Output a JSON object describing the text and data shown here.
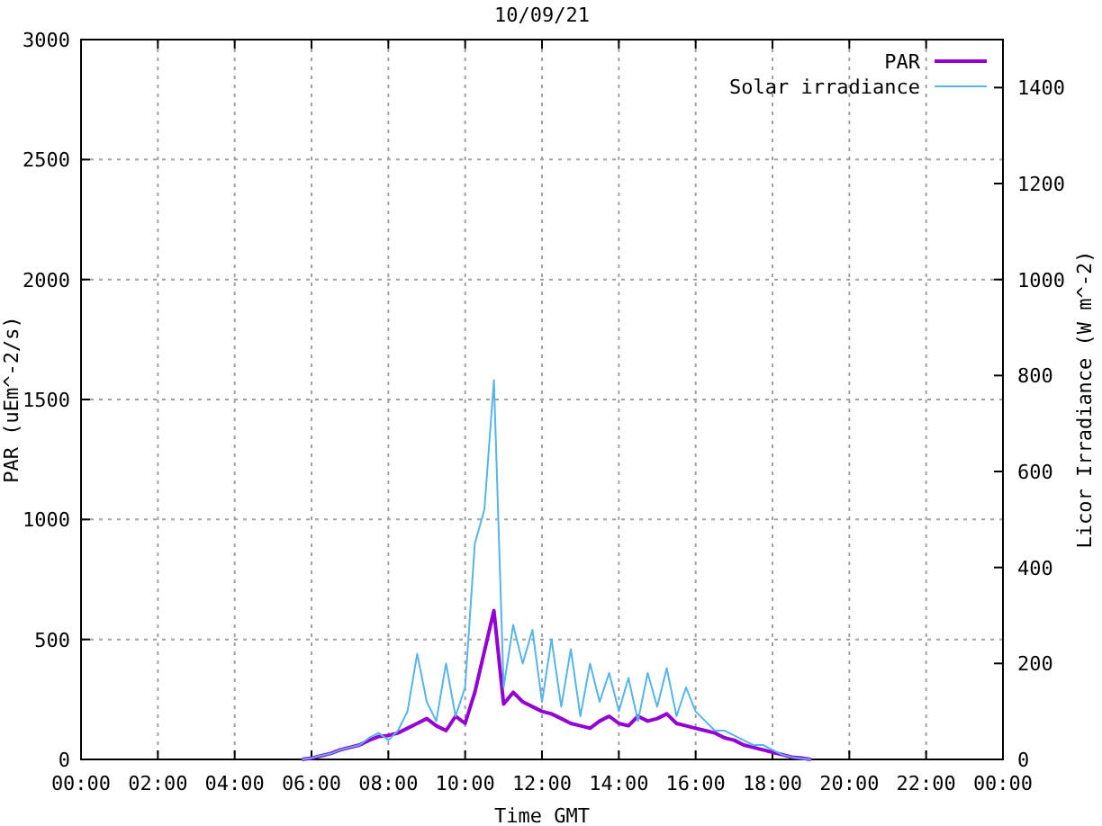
{
  "chart_data": {
    "type": "line",
    "title": "10/09/21",
    "xlabel": "Time GMT",
    "ylabel": "PAR (uEm^-2/s)",
    "y2label": "Licor Irradiance (W m^-2)",
    "grid": true,
    "legend": true,
    "xlim": [
      0,
      24
    ],
    "ylim": [
      0,
      3000
    ],
    "y2lim": [
      0,
      1500
    ],
    "y2ticks": [
      0,
      200,
      400,
      600,
      800,
      1000,
      1200,
      1400
    ],
    "xticks": [
      {
        "value": 0,
        "label": "00:00"
      },
      {
        "value": 2,
        "label": "02:00"
      },
      {
        "value": 4,
        "label": "04:00"
      },
      {
        "value": 6,
        "label": "06:00"
      },
      {
        "value": 8,
        "label": "08:00"
      },
      {
        "value": 10,
        "label": "10:00"
      },
      {
        "value": 12,
        "label": "12:00"
      },
      {
        "value": 14,
        "label": "14:00"
      },
      {
        "value": 16,
        "label": "16:00"
      },
      {
        "value": 18,
        "label": "18:00"
      },
      {
        "value": 20,
        "label": "20:00"
      },
      {
        "value": 22,
        "label": "22:00"
      },
      {
        "value": 24,
        "label": "00:00"
      }
    ],
    "yticks": [
      0,
      500,
      1000,
      1500,
      2000,
      2500,
      3000
    ],
    "x": [
      5.75,
      6,
      6.25,
      6.5,
      6.75,
      7,
      7.25,
      7.5,
      7.75,
      8,
      8.25,
      8.5,
      8.75,
      9,
      9.25,
      9.5,
      9.75,
      10,
      10.25,
      10.5,
      10.75,
      11,
      11.25,
      11.5,
      11.75,
      12,
      12.25,
      12.5,
      12.75,
      13,
      13.25,
      13.5,
      13.75,
      14,
      14.25,
      14.5,
      14.75,
      15,
      15.25,
      15.5,
      15.75,
      16,
      16.25,
      16.5,
      16.75,
      17,
      17.25,
      17.5,
      17.75,
      18,
      18.25,
      18.5,
      18.75,
      19
    ],
    "series": [
      {
        "name": "PAR",
        "color": "#9400d3",
        "values": [
          0,
          5,
          15,
          25,
          40,
          50,
          60,
          80,
          95,
          100,
          110,
          130,
          150,
          170,
          140,
          120,
          180,
          150,
          280,
          450,
          620,
          230,
          280,
          240,
          220,
          200,
          190,
          170,
          150,
          140,
          130,
          160,
          180,
          150,
          140,
          180,
          160,
          170,
          190,
          150,
          140,
          130,
          120,
          110,
          90,
          80,
          60,
          50,
          40,
          30,
          20,
          10,
          5,
          0
        ]
      },
      {
        "name": "Solar irradiance",
        "color": "#56b4e9",
        "axis": "y2",
        "values": [
          0,
          3,
          8,
          12,
          20,
          25,
          30,
          45,
          55,
          40,
          60,
          100,
          220,
          120,
          80,
          200,
          90,
          150,
          450,
          520,
          790,
          150,
          280,
          200,
          270,
          120,
          250,
          110,
          230,
          90,
          200,
          120,
          180,
          100,
          170,
          80,
          180,
          110,
          190,
          90,
          150,
          100,
          80,
          60,
          60,
          50,
          40,
          30,
          30,
          20,
          10,
          5,
          2,
          0
        ]
      }
    ]
  }
}
